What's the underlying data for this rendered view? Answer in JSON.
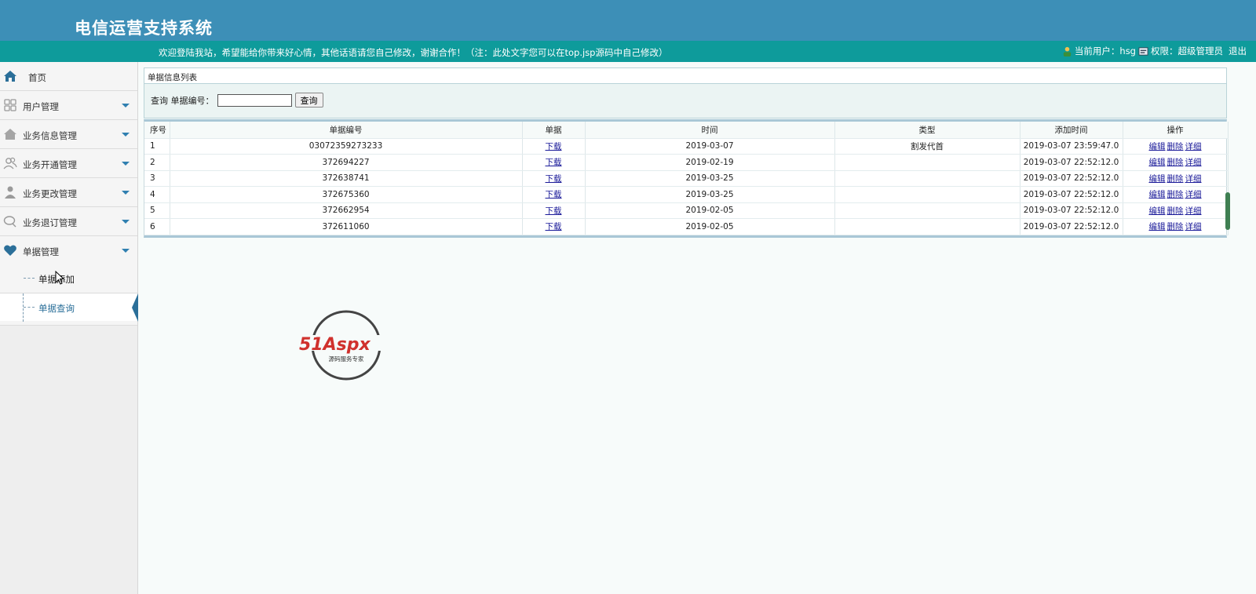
{
  "app": {
    "title": "电信运营支持系统",
    "welcome": "欢迎登陆我站，希望能给你带来好心情，其他话语请您自己修改，谢谢合作！（注：此处文字您可以在top.jsp源码中自己修改）",
    "current_user_label": "当前用户：hsg",
    "permission_label": "权限：超级管理员",
    "logout": "退出"
  },
  "sidebar": {
    "items": [
      {
        "label": "首页",
        "icon": "home-icon"
      },
      {
        "label": "用户管理",
        "icon": "grid-icon"
      },
      {
        "label": "业务信息管理",
        "icon": "house-icon"
      },
      {
        "label": "业务开通管理",
        "icon": "users-icon"
      },
      {
        "label": "业务更改管理",
        "icon": "person-icon"
      },
      {
        "label": "业务退订管理",
        "icon": "chat-icon"
      },
      {
        "label": "单据管理",
        "icon": "heart-icon"
      }
    ],
    "sub_items": [
      {
        "label": "单据添加"
      },
      {
        "label": "单据查询"
      }
    ]
  },
  "panel": {
    "title": "单据信息列表",
    "search_label": "查询 单据编号：",
    "search_value": "",
    "search_button": "查询"
  },
  "table": {
    "headers": [
      "序号",
      "单据编号",
      "单据",
      "时间",
      "类型",
      "添加时间",
      "操作"
    ],
    "rows": [
      {
        "no": "1",
        "code": "03072359273233",
        "file": "下载",
        "date": "2019-03-07",
        "type": "割发代首",
        "added": "2019-03-07 23:59:47.0"
      },
      {
        "no": "2",
        "code": "372694227",
        "file": "下载",
        "date": "2019-02-19",
        "type": "",
        "added": "2019-03-07 22:52:12.0"
      },
      {
        "no": "3",
        "code": "372638741",
        "file": "下载",
        "date": "2019-03-25",
        "type": "",
        "added": "2019-03-07 22:52:12.0"
      },
      {
        "no": "4",
        "code": "372675360",
        "file": "下载",
        "date": "2019-03-25",
        "type": "",
        "added": "2019-03-07 22:52:12.0"
      },
      {
        "no": "5",
        "code": "372662954",
        "file": "下载",
        "date": "2019-02-05",
        "type": "",
        "added": "2019-03-07 22:52:12.0"
      },
      {
        "no": "6",
        "code": "372611060",
        "file": "下载",
        "date": "2019-02-05",
        "type": "",
        "added": "2019-03-07 22:52:12.0"
      }
    ],
    "ops": {
      "edit": "编辑",
      "delete": "删除",
      "detail": "详细"
    }
  },
  "watermark": {
    "brand": "51Aspx",
    "slogan": "源码服务专家"
  },
  "colors": {
    "header": "#3d8fb7",
    "infobar": "#0e9b9b",
    "accent": "#2b6f99"
  }
}
